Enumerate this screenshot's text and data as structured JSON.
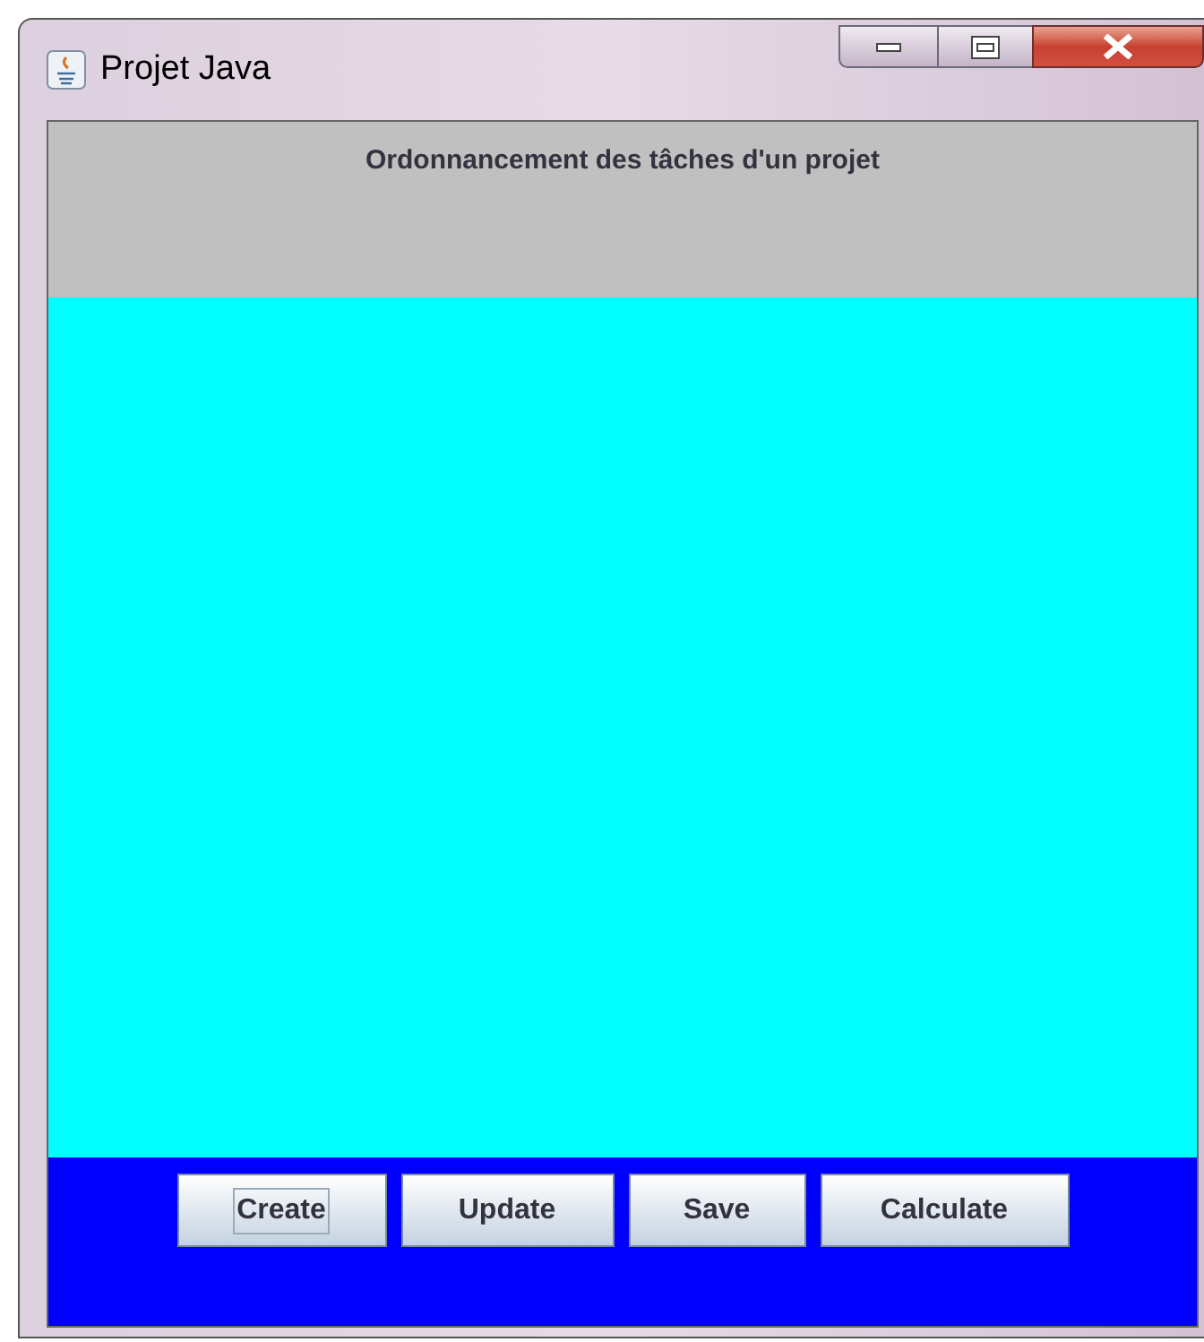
{
  "window": {
    "title": "Projet Java"
  },
  "header": {
    "title": "Ordonnancement des tâches d'un projet"
  },
  "buttons": [
    {
      "label": "Create",
      "focused": true
    },
    {
      "label": "Update",
      "focused": false
    },
    {
      "label": "Save",
      "focused": false
    },
    {
      "label": "Calculate",
      "focused": false
    }
  ]
}
